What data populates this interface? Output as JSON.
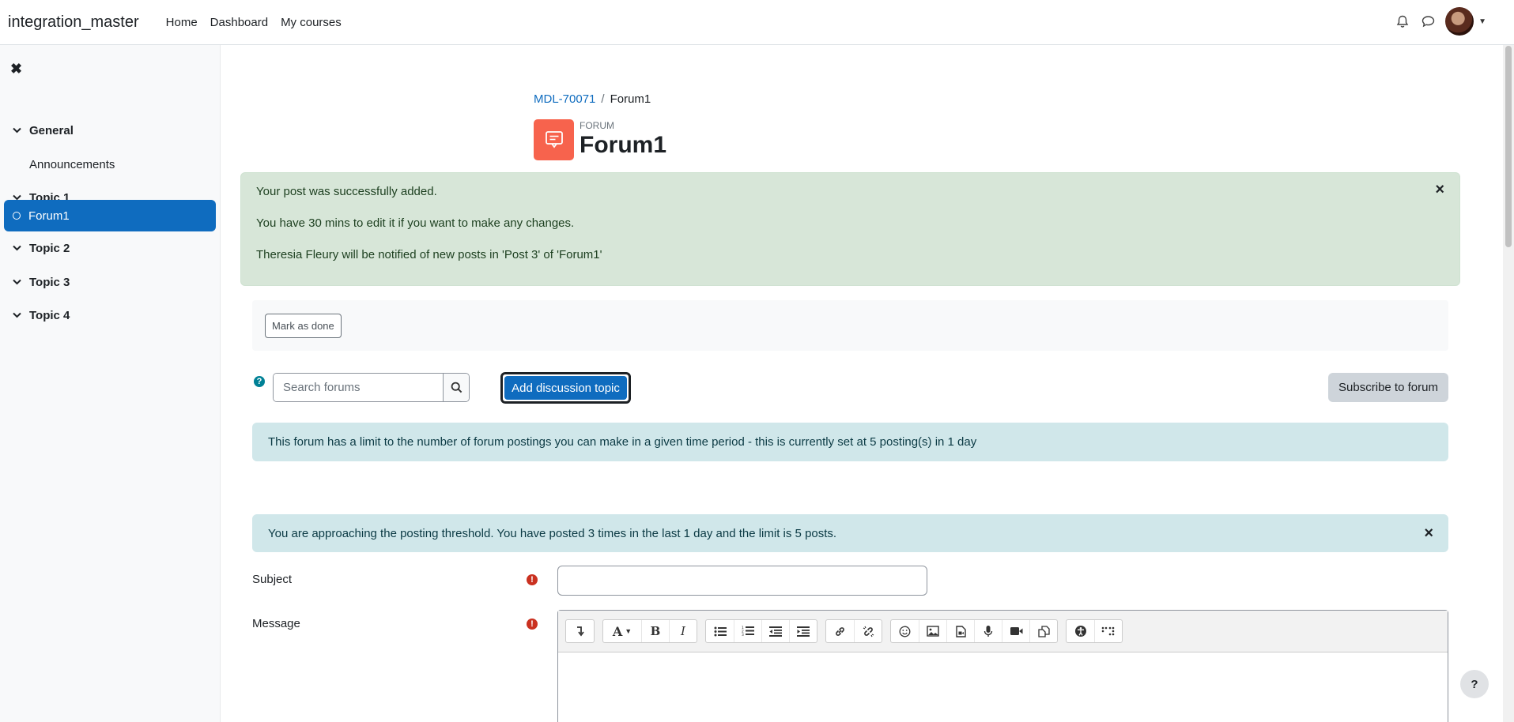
{
  "navbar": {
    "site_name": "integration_master",
    "links": [
      "Home",
      "Dashboard",
      "My courses"
    ],
    "icons": [
      "bell-icon",
      "chat-icon"
    ]
  },
  "sidebar": {
    "items": [
      {
        "label": "General",
        "type": "section"
      },
      {
        "label": "Announcements",
        "type": "activity"
      },
      {
        "label": "Topic 1",
        "type": "section"
      },
      {
        "label": "Forum1",
        "type": "activity",
        "active": true
      },
      {
        "label": "Topic 2",
        "type": "section"
      },
      {
        "label": "Topic 3",
        "type": "section"
      },
      {
        "label": "Topic 4",
        "type": "section"
      }
    ]
  },
  "breadcrumb": {
    "course": "MDL-70071",
    "separator": "/",
    "current": "Forum1"
  },
  "header": {
    "kicker": "FORUM",
    "title": "Forum1",
    "icon_color": "#f7634d"
  },
  "success_alert": {
    "lines": [
      "Your post was successfully added.",
      "You have 30 mins to edit it if you want to make any changes.",
      "Theresia Fleury will be notified of new posts in 'Post 3' of 'Forum1'"
    ]
  },
  "completion": {
    "button_label": "Mark as done"
  },
  "actions": {
    "search_placeholder": "Search forums",
    "add_topic_label": "Add discussion topic",
    "subscribe_label": "Subscribe to forum"
  },
  "info_alerts": {
    "limit": "This forum has a limit to the number of forum postings you can make in a given time period - this is currently set at 5 posting(s) in 1 day",
    "threshold": "You are approaching the posting threshold. You have posted 3 times in the last 1 day and the limit is 5 posts."
  },
  "form": {
    "subject_label": "Subject",
    "subject_value": "",
    "message_label": "Message"
  },
  "editor_toolbar": [
    [
      "collapse"
    ],
    [
      "font-style",
      "bold",
      "italic"
    ],
    [
      "bullet-list",
      "numbered-list",
      "outdent",
      "indent"
    ],
    [
      "link",
      "unlink"
    ],
    [
      "emoji",
      "image",
      "media",
      "record-audio",
      "record-video",
      "manage-files"
    ],
    [
      "accessibility-checker",
      "screenreader-helper"
    ]
  ],
  "colors": {
    "primary": "#0f6cbf",
    "success_bg": "#d7e6d8",
    "info_bg": "#d0e7ea",
    "required": "#ca3120"
  }
}
